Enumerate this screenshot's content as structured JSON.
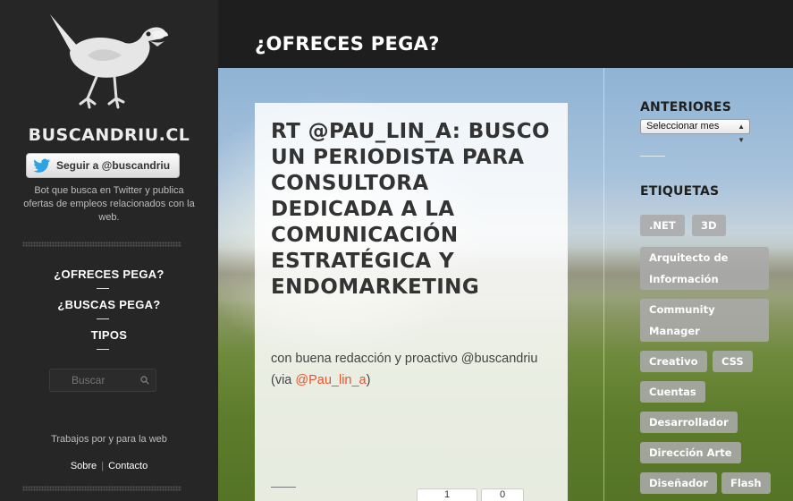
{
  "site": {
    "title": "BUSCANDRIU.CL",
    "follow_label": "Seguir a @buscandriu",
    "tagline": "Bot que busca en Twitter y publica ofertas de empleos relacionados con la web."
  },
  "nav": {
    "items": [
      {
        "label": "¿OFRECES PEGA?"
      },
      {
        "label": "¿BUSCAS PEGA?"
      },
      {
        "label": "TIPOS"
      }
    ]
  },
  "search": {
    "placeholder": "Buscar"
  },
  "footer": {
    "text": "Trabajos por y para la web",
    "links": [
      {
        "label": "Sobre"
      },
      {
        "label": "Contacto"
      }
    ],
    "separator": "|"
  },
  "header": {
    "title": "¿OFRECES PEGA?"
  },
  "post": {
    "title": "RT @PAU_LIN_A: BUSCO UN PERIODISTA PARA CONSULTORA DEDICADA A LA COMUNICACIÓN ESTRATÉGICA Y ENDOMARKETING",
    "excerpt_start": "con buena redacción y proactivo @buscandriu (via ",
    "excerpt_link": "@Pau_lin_a",
    "excerpt_end": ")",
    "share_label": "1",
    "like_label": "0"
  },
  "archive": {
    "heading": "ANTERIORES",
    "select_value": "Seleccionar mes"
  },
  "tags_section": {
    "heading": "ETIQUETAS",
    "tags": [
      ".NET",
      "3D",
      "Arquitecto de Información",
      "Community Manager",
      "Creativo",
      "CSS",
      "Cuentas",
      "Desarrollador",
      "Dirección Arte",
      "Diseñador",
      "Flash"
    ]
  },
  "colors": {
    "sidebar_bg": "#262626",
    "header_bg": "#1e1e1e",
    "link_accent": "#e8532f",
    "tag_bg": "#aaaaaa"
  },
  "icons": [
    "bird-logo-icon",
    "twitter-bird-icon",
    "search-icon",
    "caret-icon"
  ]
}
